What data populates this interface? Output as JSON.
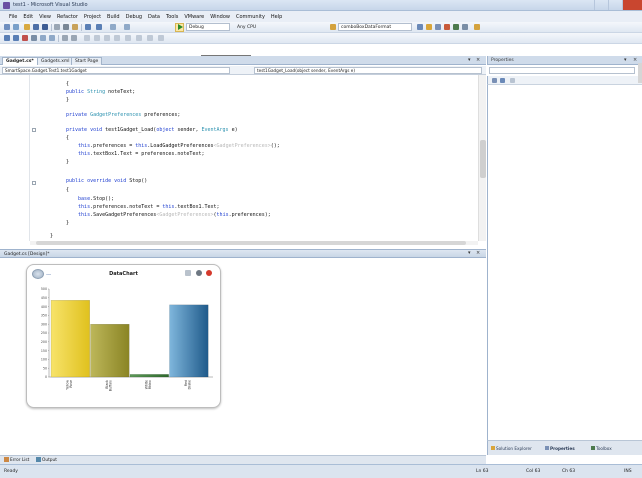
{
  "window": {
    "title": "test1 - Microsoft Visual Studio"
  },
  "menu": [
    "File",
    "Edit",
    "View",
    "Refactor",
    "Project",
    "Build",
    "Debug",
    "Data",
    "Tools",
    "VMware",
    "Window",
    "Community",
    "Help"
  ],
  "toolbar": {
    "debug_config": "Debug",
    "platform": "Any CPU",
    "find_combo": "comboBoxDataFormat",
    "start_debugging_tooltip": "Start Debugging (F5)"
  },
  "tabs": [
    {
      "label": "Gadget.cs*",
      "active": true
    },
    {
      "label": "Gadgets.xml",
      "active": false
    },
    {
      "label": "Start Page",
      "active": false
    }
  ],
  "nav": {
    "class_combo": "SmartSpace.Gadget.Test1.test1Gadget",
    "member_combo": "test1Gadget_Load(object sender, EventArgs e)"
  },
  "code": {
    "l1": "{",
    "l2": "    public String noteText;",
    "l3": "}",
    "l4": "private GadgetPreferences preferences;",
    "l5": "private void test1Gadget_Load(object sender, EventArgs e)",
    "l6": "{",
    "l7a": "    this.preferences = this.LoadGadgetPreferences",
    "l7b": "<GadgetPreferences>",
    "l7c": "();",
    "l8": "    this.textBox1.Text = preferences.noteText;",
    "l9": "}",
    "l10": "public override void Stop()",
    "l11": "{",
    "l12": "    base.Stop();",
    "l13": "    this.preferences.noteText = this.textBox1.Text;",
    "l14a": "    this.SaveGadgetPreferences",
    "l14b": "<GadgetPreferences>",
    "l14c": "(this.preferences);",
    "l15": "}",
    "l16": "}"
  },
  "designer": {
    "tab_label": "Gadget.cs [Design]*"
  },
  "gadget": {
    "title": "DataChart",
    "dots": "-----"
  },
  "chart_data": {
    "type": "bar",
    "categories": [
      "Yellow Rose",
      "Black Buffalo",
      "White Rhino",
      "Red Drake"
    ],
    "values": [
      436,
      300,
      15,
      410
    ],
    "colors": [
      "#f2d438",
      "#a8a23a",
      "#3d7a3a",
      "#2f6f9e"
    ],
    "yticks": [
      "0",
      "50",
      "100",
      "150",
      "200",
      "250",
      "300",
      "350",
      "400",
      "450",
      "500"
    ],
    "ylim": [
      0,
      500
    ]
  },
  "output_tabs": {
    "error_list": "Error List",
    "output": "Output"
  },
  "right_panel": {
    "title": "Properties",
    "tabs": [
      "Solution Explorer",
      "Properties",
      "Toolbox"
    ]
  },
  "status": {
    "left": "Ready",
    "ln": "Ln 63",
    "col": "Col 63",
    "ch": "Ch 63",
    "mode": "INS"
  }
}
